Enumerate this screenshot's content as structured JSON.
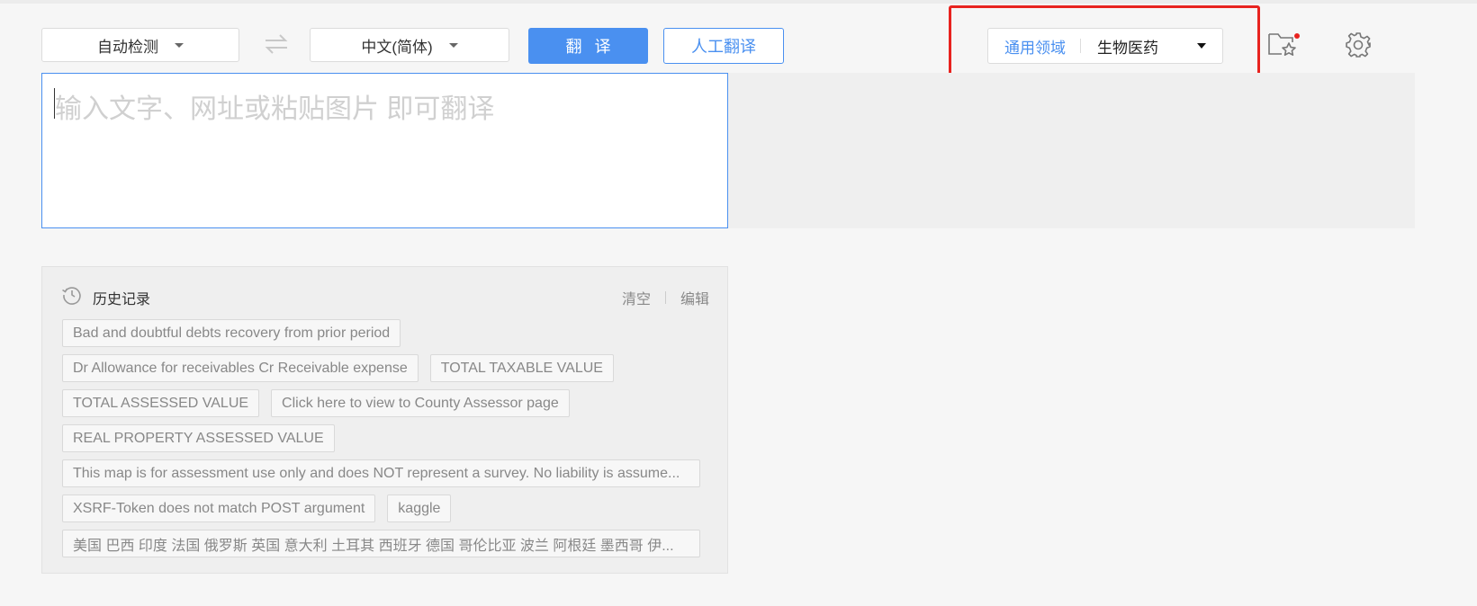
{
  "toolbar": {
    "source_lang": "自动检测",
    "target_lang": "中文(简体)",
    "translate_label": "翻译",
    "human_translate_label": "人工翻译"
  },
  "domain": {
    "general_label": "通用领域",
    "selected_label": "生物医药"
  },
  "input": {
    "placeholder": "输入文字、网址或粘贴图片 即可翻译"
  },
  "history": {
    "title": "历史记录",
    "clear_label": "清空",
    "edit_label": "编辑",
    "items": [
      "Bad and doubtful debts recovery from prior period",
      "Dr Allowance for receivables Cr Receivable expense",
      "TOTAL TAXABLE VALUE",
      "TOTAL ASSESSED VALUE",
      "Click here to view to County Assessor page",
      "REAL PROPERTY ASSESSED VALUE",
      "This map is for assessment use only and does NOT represent a survey. No liability is assume...",
      "XSRF-Token does not match POST argument",
      "kaggle",
      "美国 巴西 印度 法国 俄罗斯 英国 意大利 土耳其 西班牙 德国 哥伦比亚 波兰 阿根廷 墨西哥 伊..."
    ]
  },
  "colors": {
    "accent": "#4a90f0",
    "highlight_box": "#e8231f",
    "notification_dot": "#e8231f"
  },
  "icons": [
    "swap-icon",
    "favorites-folder-icon",
    "settings-gear-icon",
    "history-clock-icon"
  ]
}
